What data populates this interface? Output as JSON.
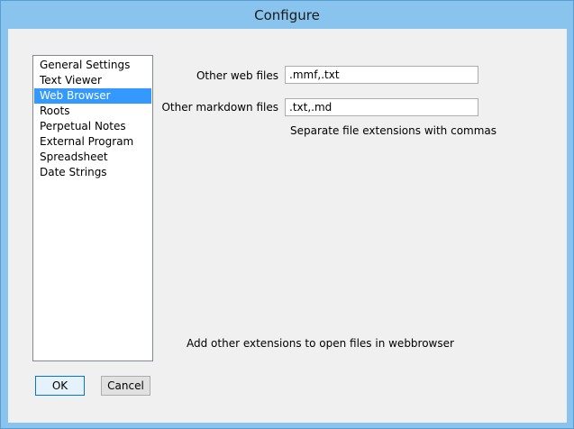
{
  "window": {
    "title": "Configure"
  },
  "sidebar": {
    "items": [
      {
        "label": "General Settings",
        "selected": false
      },
      {
        "label": "Text Viewer",
        "selected": false
      },
      {
        "label": "Web Browser",
        "selected": true
      },
      {
        "label": "Roots",
        "selected": false
      },
      {
        "label": "Perpetual Notes",
        "selected": false
      },
      {
        "label": "External Program",
        "selected": false
      },
      {
        "label": "Spreadsheet",
        "selected": false
      },
      {
        "label": "Date Strings",
        "selected": false
      }
    ]
  },
  "settings": {
    "web_files": {
      "label": "Other web files",
      "value": ".mmf,.txt"
    },
    "markdown_files": {
      "label": "Other markdown files",
      "value": ".txt,.md"
    },
    "hint": "Separate file extensions with commas",
    "description": "Add other extensions to open files in webbrowser"
  },
  "buttons": {
    "ok_label": "OK",
    "cancel_label": "Cancel"
  },
  "colors": {
    "title_bar": "#89c4ee",
    "selection": "#3399ff",
    "client_bg": "#f0f0f0"
  }
}
